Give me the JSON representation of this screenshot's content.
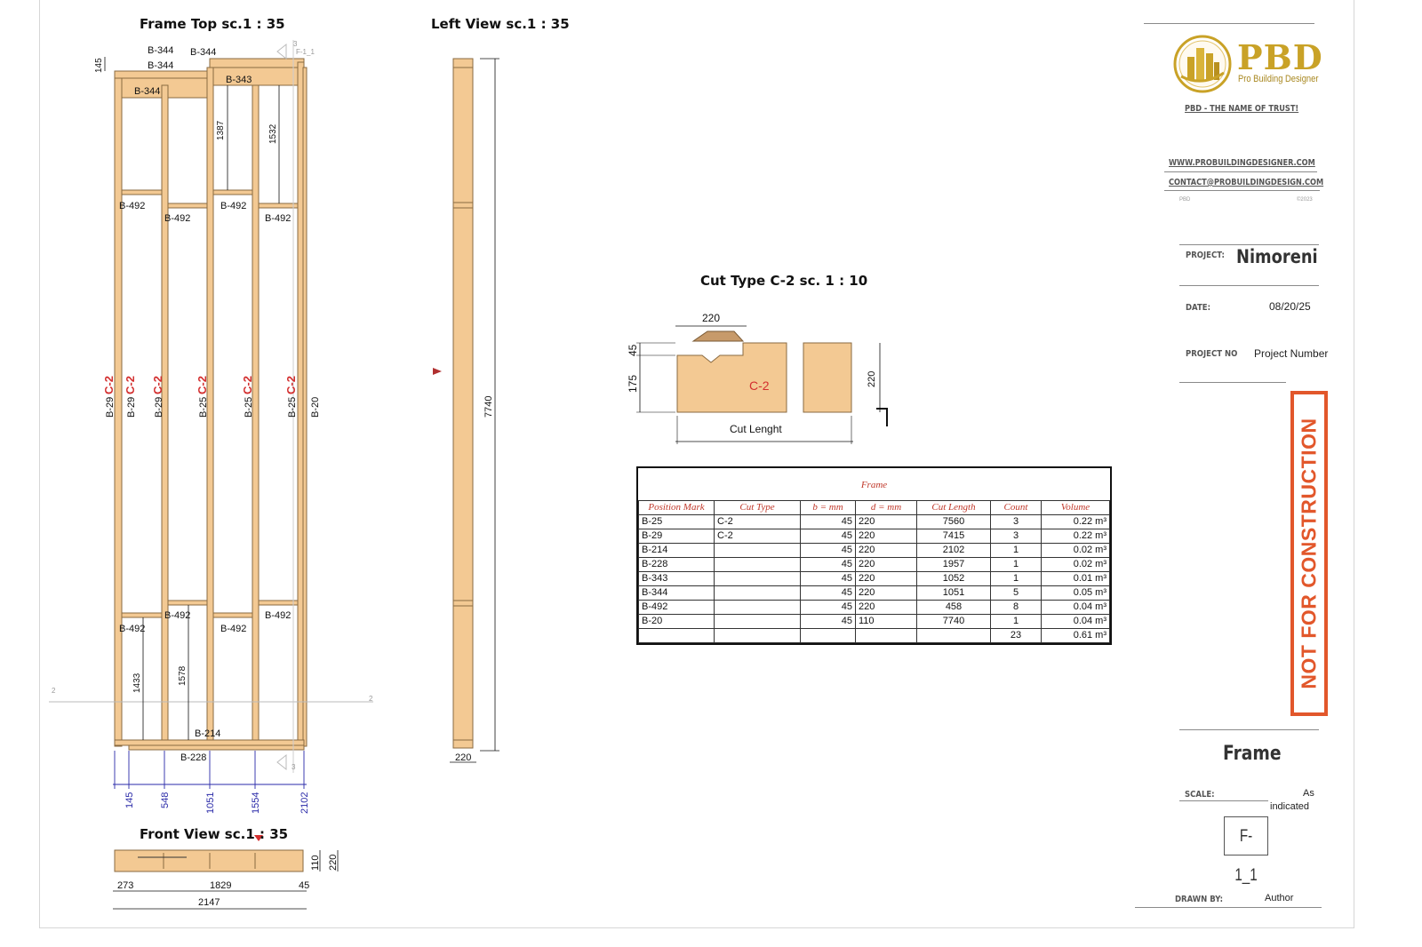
{
  "views": {
    "frame_top_title": "Frame Top sc.1 : 35",
    "left_view_title": "Left View sc.1 : 35",
    "front_view_title": "Front View sc.1 : 35",
    "cut_type_title": "Cut Type C-2 sc. 1 : 10"
  },
  "frame_top": {
    "top_labels": [
      "B-344",
      "B-344",
      "B-344",
      "B-344",
      "B-343"
    ],
    "dim_top": "145",
    "dim_1387": "1387",
    "dim_1532": "1532",
    "blocking_upper": [
      "B-492",
      "B-492",
      "B-492",
      "B-492"
    ],
    "blocking_lower": [
      "B-492",
      "B-492",
      "B-492",
      "B-492"
    ],
    "stud_labels": [
      "B-29",
      "B-29",
      "B-29",
      "B-25",
      "B-25",
      "B-25",
      "B-20"
    ],
    "cut_labels": [
      "C-2",
      "C-2",
      "C-2",
      "C-2",
      "C-2",
      "C-2"
    ],
    "dim_1433": "1433",
    "dim_1578": "1578",
    "bottom_labels": [
      "B-214",
      "B-228"
    ],
    "bottom_dims": [
      "145",
      "548",
      "1051",
      "1554",
      "2102"
    ],
    "section_marks": [
      "2",
      "2",
      "3",
      "3"
    ],
    "section_ref": "F-1_1"
  },
  "left_view": {
    "height_dim": "7740",
    "width_dim": "220"
  },
  "front_view": {
    "dims_row1": [
      "273",
      "1829",
      "45"
    ],
    "dim_total": "2147",
    "dims_right": [
      "110",
      "220"
    ]
  },
  "cut_type": {
    "dim_top": "220",
    "dim_45": "45",
    "dim_175": "175",
    "dim_220_side": "220",
    "cut_label": "C-2",
    "cut_length_label": "Cut Lenght"
  },
  "schedule": {
    "title": "Frame",
    "headers": [
      "Position Mark",
      "Cut Type",
      "b = mm",
      "d = mm",
      "Cut Length",
      "Count",
      "Volume"
    ],
    "rows": [
      [
        "B-25",
        "C-2",
        "45",
        "220",
        "7560",
        "3",
        "0.22 m³"
      ],
      [
        "B-29",
        "C-2",
        "45",
        "220",
        "7415",
        "3",
        "0.22 m³"
      ],
      [
        "B-214",
        "",
        "45",
        "220",
        "2102",
        "1",
        "0.02 m³"
      ],
      [
        "B-228",
        "",
        "45",
        "220",
        "1957",
        "1",
        "0.02 m³"
      ],
      [
        "B-343",
        "",
        "45",
        "220",
        "1052",
        "1",
        "0.01 m³"
      ],
      [
        "B-344",
        "",
        "45",
        "220",
        "1051",
        "5",
        "0.05 m³"
      ],
      [
        "B-492",
        "",
        "45",
        "220",
        "458",
        "8",
        "0.04 m³"
      ],
      [
        "B-20",
        "",
        "45",
        "110",
        "7740",
        "1",
        "0.04 m³"
      ]
    ],
    "total_count": "23",
    "total_volume": "0.61 m³"
  },
  "title_block": {
    "logo_text": "PBD",
    "logo_sub": "Pro Building Designer",
    "tagline": "PBD - THE NAME OF TRUST!",
    "website": "WWW.PROBUILDINGDESIGNER.COM",
    "email": "CONTACT@PROBUILDINGDESIGN.COM",
    "small_left": "PBD",
    "small_right": "©2023",
    "project_label": "PROJECT:",
    "project_value": "Nimoreni",
    "date_label": "DATE:",
    "date_value": "08/20/25",
    "project_no_label": "PROJECT NO",
    "project_no_value": "Project Number",
    "stamp": "NOT FOR CONSTRUCTION",
    "sheet_name": "Frame",
    "scale_label": "SCALE:",
    "scale_value_1": "As",
    "scale_value_2": "indicated",
    "sheet_number": "F-1_1",
    "drawn_by_label": "DRAWN BY:",
    "drawn_by_value": "Author"
  },
  "colors": {
    "wood": "#f3c993",
    "wood_edge": "#8a6a40",
    "cut_red": "#d32f2f",
    "dim_blue": "#2a2aa8",
    "stamp_orange": "#e2572b",
    "logo_gold": "#c9a227"
  }
}
